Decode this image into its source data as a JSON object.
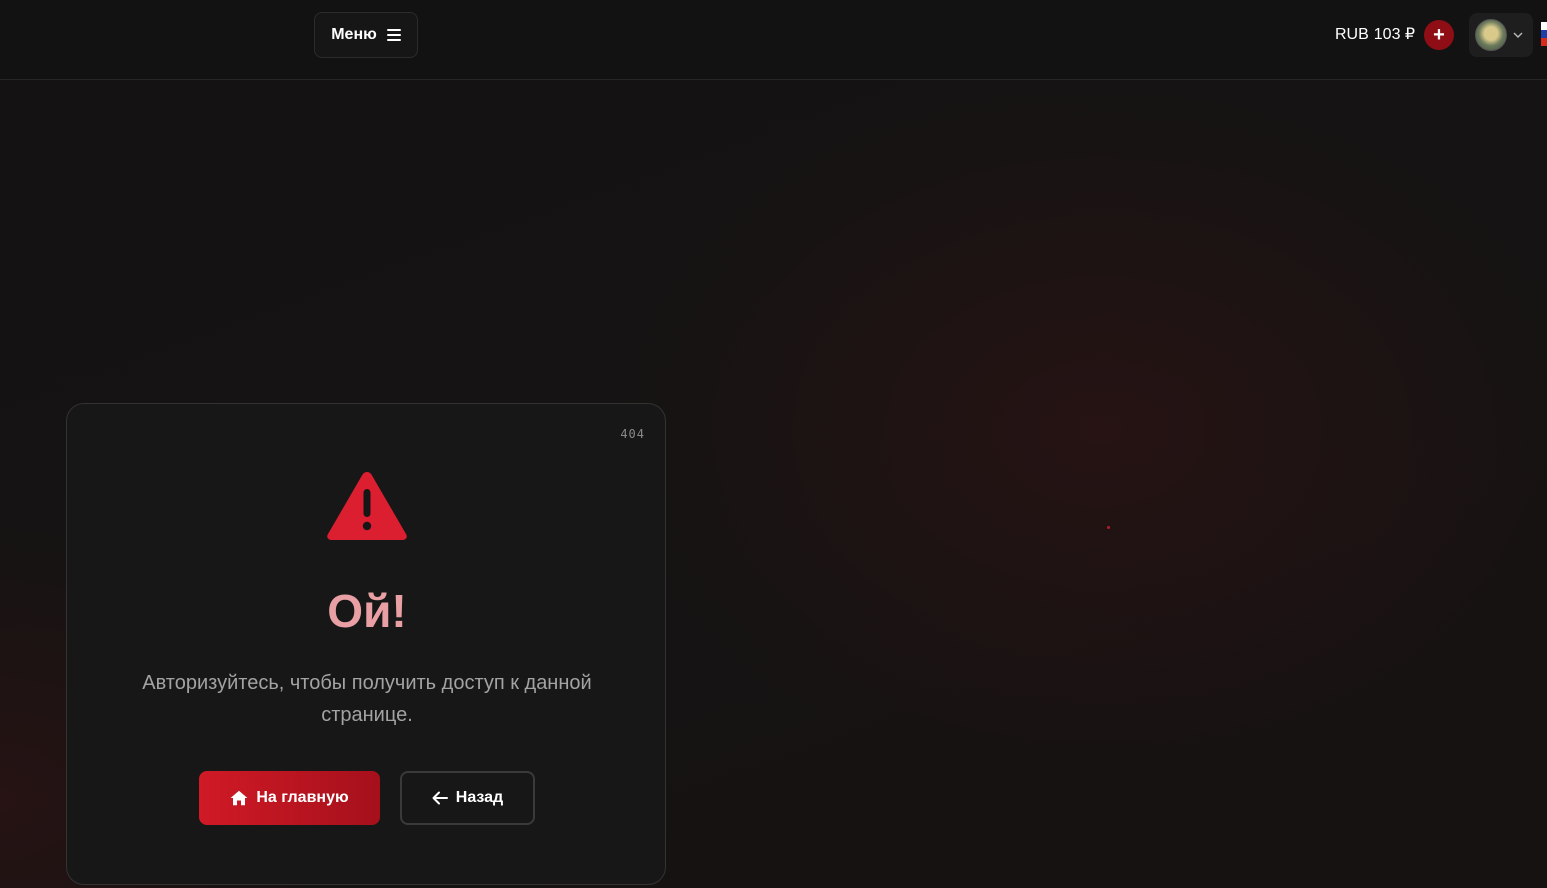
{
  "header": {
    "menu_label": "Меню",
    "balance": {
      "currency": "RUB",
      "amount": "103 ₽"
    },
    "add_label": "+"
  },
  "error_card": {
    "code": "404",
    "title": "Ой!",
    "message": "Авторизуйтесь, чтобы получить доступ к данной странице.",
    "home_label": "На главную",
    "back_label": "Назад"
  },
  "icons": {
    "menu": "hamburger-icon",
    "avatar_dropdown": "chevron-down-icon",
    "warning": "warning-triangle-icon",
    "home": "home-icon",
    "back": "arrow-left-icon",
    "flag": "flag-ru-icon"
  },
  "colors": {
    "accent": "#d01a26",
    "accent_dark": "#8f0e16",
    "title": "#e8a0a4",
    "text_muted": "#a3a3a3",
    "background": "#121212",
    "card": "#171717"
  }
}
